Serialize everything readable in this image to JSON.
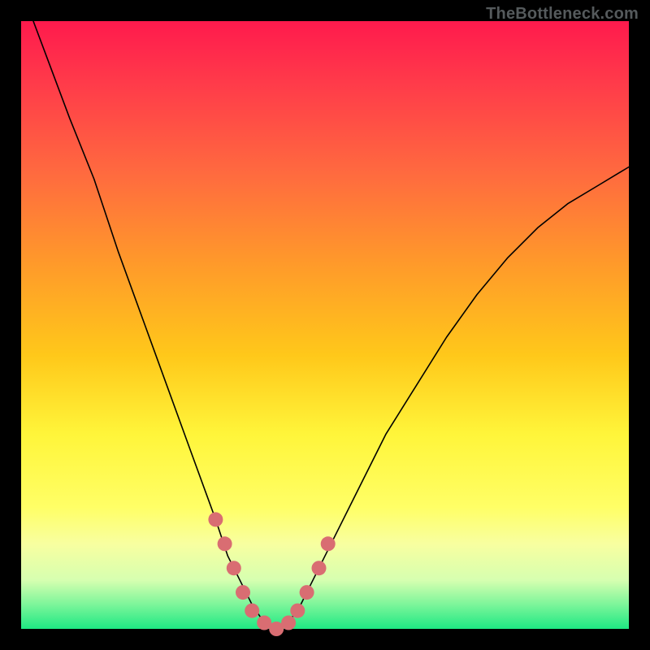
{
  "watermark": "TheBottleneck.com",
  "colors": {
    "background_border": "#000000",
    "gradient_top": "#ff1a4d",
    "gradient_bottom": "#1ee883",
    "curve": "#000000",
    "marker": "#d96d72",
    "watermark": "#555a5c"
  },
  "chart_data": {
    "type": "line",
    "title": "",
    "xlabel": "",
    "ylabel": "",
    "xlim": [
      0,
      100
    ],
    "ylim": [
      0,
      100
    ],
    "series": [
      {
        "name": "bottleneck-curve",
        "x": [
          2,
          5,
          8,
          12,
          16,
          20,
          24,
          28,
          32,
          34,
          36,
          38,
          40,
          42,
          44,
          46,
          50,
          55,
          60,
          65,
          70,
          75,
          80,
          85,
          90,
          95,
          100
        ],
        "y": [
          100,
          92,
          84,
          74,
          62,
          51,
          40,
          29,
          18,
          12,
          8,
          4,
          1,
          0,
          1,
          4,
          12,
          22,
          32,
          40,
          48,
          55,
          61,
          66,
          70,
          73,
          76
        ]
      }
    ],
    "markers": {
      "name": "highlighted-range",
      "points": [
        {
          "x": 32,
          "y": 18
        },
        {
          "x": 33.5,
          "y": 14
        },
        {
          "x": 35,
          "y": 10
        },
        {
          "x": 36.5,
          "y": 6
        },
        {
          "x": 38,
          "y": 3
        },
        {
          "x": 40,
          "y": 1
        },
        {
          "x": 42,
          "y": 0
        },
        {
          "x": 44,
          "y": 1
        },
        {
          "x": 45.5,
          "y": 3
        },
        {
          "x": 47,
          "y": 6
        },
        {
          "x": 49,
          "y": 10
        },
        {
          "x": 50.5,
          "y": 14
        }
      ]
    },
    "annotations": []
  }
}
